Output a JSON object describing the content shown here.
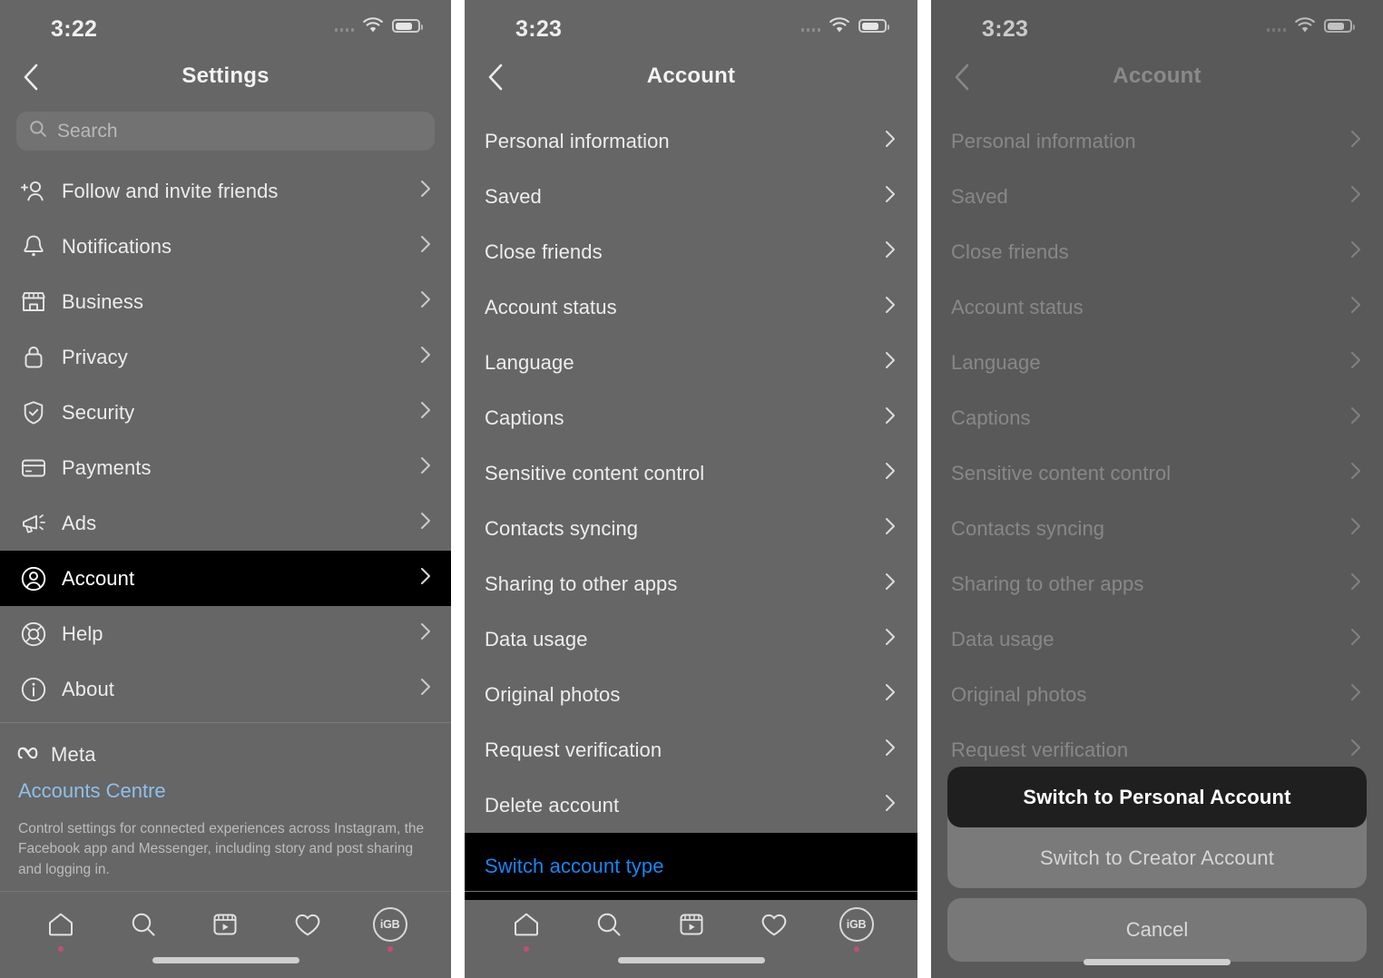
{
  "panels": [
    {
      "id": "settings",
      "status": {
        "time": "3:22",
        "signal_icon": "signal-bars-icon",
        "wifi_icon": "wifi-icon",
        "battery_icon": "battery-icon"
      },
      "nav": {
        "back_icon": "chevron-left-icon",
        "title": "Settings"
      },
      "search": {
        "placeholder": "Search",
        "icon": "search-icon"
      },
      "menu": [
        {
          "label": "Follow and invite friends",
          "icon": "add-person-icon",
          "selected": false
        },
        {
          "label": "Notifications",
          "icon": "bell-icon",
          "selected": false
        },
        {
          "label": "Business",
          "icon": "storefront-icon",
          "selected": false
        },
        {
          "label": "Privacy",
          "icon": "lock-icon",
          "selected": false
        },
        {
          "label": "Security",
          "icon": "shield-check-icon",
          "selected": false
        },
        {
          "label": "Payments",
          "icon": "credit-card-icon",
          "selected": false
        },
        {
          "label": "Ads",
          "icon": "megaphone-icon",
          "selected": false
        },
        {
          "label": "Account",
          "icon": "user-circle-icon",
          "selected": true
        },
        {
          "label": "Help",
          "icon": "life-ring-icon",
          "selected": false
        },
        {
          "label": "About",
          "icon": "info-circle-icon",
          "selected": false
        }
      ],
      "meta": {
        "brand": "Meta",
        "brand_icon": "meta-infinity-icon",
        "link": "Accounts Centre",
        "description": "Control settings for connected experiences across Instagram, the Facebook app and Messenger, including story and post sharing and logging in."
      },
      "tabbar": [
        {
          "icon": "home-icon",
          "badge": true
        },
        {
          "icon": "search-icon",
          "badge": false
        },
        {
          "icon": "reels-icon",
          "badge": false
        },
        {
          "icon": "heart-icon",
          "badge": false
        },
        {
          "icon": "profile-avatar-icon",
          "badge": true,
          "avatar_text": "iGB"
        }
      ]
    },
    {
      "id": "account",
      "status": {
        "time": "3:23",
        "signal_icon": "signal-bars-icon",
        "wifi_icon": "wifi-icon",
        "battery_icon": "battery-icon"
      },
      "nav": {
        "back_icon": "chevron-left-icon",
        "title": "Account"
      },
      "menu": [
        {
          "label": "Personal information",
          "highlight": false
        },
        {
          "label": "Saved",
          "highlight": false
        },
        {
          "label": "Close friends",
          "highlight": false
        },
        {
          "label": "Account status",
          "highlight": false
        },
        {
          "label": "Language",
          "highlight": false
        },
        {
          "label": "Captions",
          "highlight": false
        },
        {
          "label": "Sensitive content control",
          "highlight": false
        },
        {
          "label": "Contacts syncing",
          "highlight": false
        },
        {
          "label": "Sharing to other apps",
          "highlight": false
        },
        {
          "label": "Data usage",
          "highlight": false
        },
        {
          "label": "Original photos",
          "highlight": false
        },
        {
          "label": "Request verification",
          "highlight": false
        },
        {
          "label": "Delete account",
          "highlight": false
        },
        {
          "label": "Switch account type",
          "highlight": true
        }
      ],
      "tabbar": [
        {
          "icon": "home-icon",
          "badge": true
        },
        {
          "icon": "search-icon",
          "badge": false
        },
        {
          "icon": "reels-icon",
          "badge": false
        },
        {
          "icon": "heart-icon",
          "badge": false
        },
        {
          "icon": "profile-avatar-icon",
          "badge": true,
          "avatar_text": "iGB"
        }
      ]
    },
    {
      "id": "account-sheet",
      "status": {
        "time": "3:23",
        "signal_icon": "signal-bars-icon",
        "wifi_icon": "wifi-icon",
        "battery_icon": "battery-icon"
      },
      "nav": {
        "back_icon": "chevron-left-icon",
        "title": "Account"
      },
      "menu": [
        {
          "label": "Personal information"
        },
        {
          "label": "Saved"
        },
        {
          "label": "Close friends"
        },
        {
          "label": "Account status"
        },
        {
          "label": "Language"
        },
        {
          "label": "Captions"
        },
        {
          "label": "Sensitive content control"
        },
        {
          "label": "Contacts syncing"
        },
        {
          "label": "Sharing to other apps"
        },
        {
          "label": "Data usage"
        },
        {
          "label": "Original photos"
        },
        {
          "label": "Request verification"
        }
      ],
      "sheet": {
        "options": [
          {
            "label": "Switch to Personal Account",
            "primary": true
          },
          {
            "label": "Switch to Creator Account",
            "primary": false
          }
        ],
        "cancel": "Cancel"
      }
    }
  ],
  "colors": {
    "panel_background": "#666666",
    "highlight_background": "#000000",
    "link_blue": "#1487f6",
    "accounts_centre_blue": "#8fc0e8",
    "sheet_primary": "#1f1f1f",
    "badge_dot": "#c05070"
  }
}
